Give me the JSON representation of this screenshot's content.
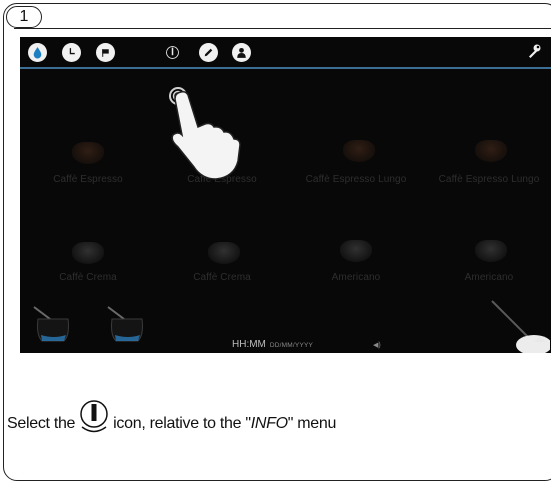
{
  "step_number": "1",
  "screen": {
    "topbar_icons": [
      "water-drop-icon",
      "clock-icon",
      "flag-icon",
      "info-icon",
      "pencil-icon",
      "user-icon"
    ],
    "settings_icon": "wrench-icon",
    "accent_color": "#3d6f95",
    "beverages_row1": [
      "Caffè Espresso",
      "Caffè Espresso",
      "Caffè Espresso Lungo",
      "Caffè Espresso Lungo"
    ],
    "beverages_row2": [
      "Caffè Crema",
      "Caffè Crema",
      "Americano",
      "Americano"
    ],
    "status_time": "HH:MM",
    "status_date": "DD/MM/YYYY"
  },
  "instruction": {
    "prefix": "Select the",
    "middle": "icon, relative to the \"",
    "menu_name": "INFO",
    "suffix": "\" menu"
  }
}
